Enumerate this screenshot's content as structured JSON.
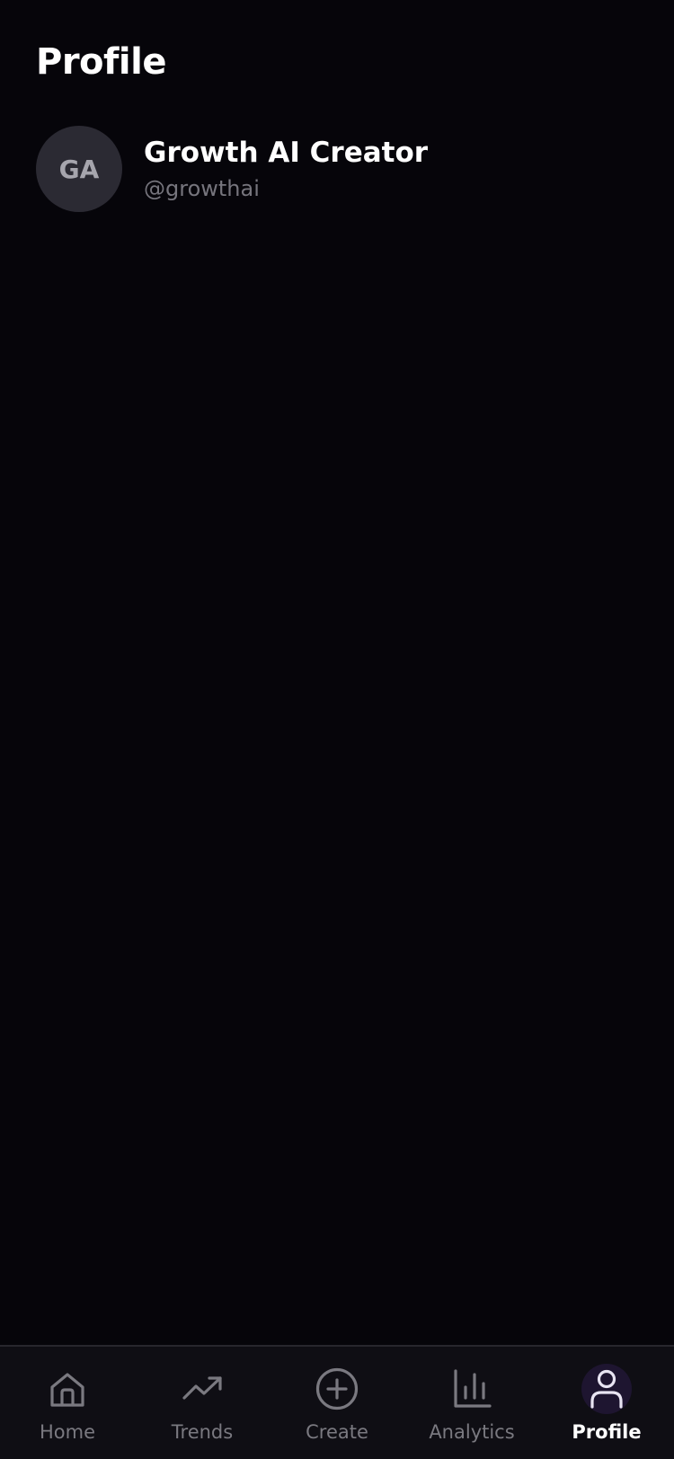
{
  "page": {
    "title": "Profile"
  },
  "profile": {
    "initials": "GA",
    "name": "Growth AI Creator",
    "handle": "@growthai"
  },
  "tabs": [
    {
      "label": "Home",
      "icon": "home-icon",
      "active": false
    },
    {
      "label": "Trends",
      "icon": "trending-up-icon",
      "active": false
    },
    {
      "label": "Create",
      "icon": "plus-circle-icon",
      "active": false
    },
    {
      "label": "Analytics",
      "icon": "bar-chart-icon",
      "active": false
    },
    {
      "label": "Profile",
      "icon": "user-icon",
      "active": true
    }
  ],
  "colors": {
    "background": "#06050a",
    "tab_bar": "#0f0e14",
    "inactive": "#7a7980",
    "active_bg": "#1e1530",
    "active_icon": "#e8e4f2"
  }
}
